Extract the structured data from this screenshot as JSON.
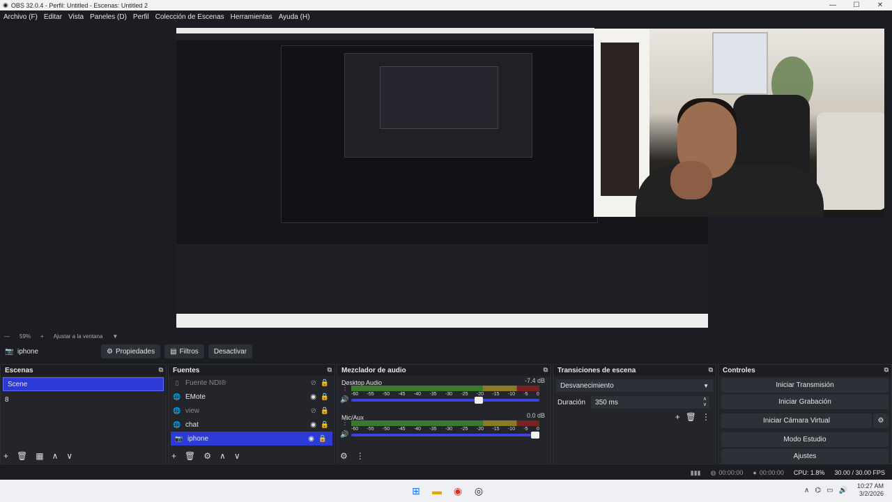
{
  "window": {
    "title": "OBS 32.0.4 - Perfil: Untitled - Escenas: Untitled 2",
    "min": "—",
    "max": "☐",
    "close": "✕"
  },
  "menu": [
    "Archivo (F)",
    "Editar",
    "Vista",
    "Paneles (D)",
    "Perfil",
    "Colección de Escenas",
    "Herramientas",
    "Ayuda (H)"
  ],
  "zoom": {
    "level": "59%",
    "fit": "Ajustar a la ventana"
  },
  "source_toolbar": {
    "name": "iphone",
    "properties": "Propiedades",
    "filters": "Filtros",
    "deactivate": "Desactivar"
  },
  "scenes": {
    "title": "Escenas",
    "items": [
      "Scene",
      "8"
    ]
  },
  "sources": {
    "title": "Fuentes",
    "items": [
      {
        "name": "Fuente NDI®",
        "icon": "ndi-icon",
        "dim": true
      },
      {
        "name": "EMote",
        "icon": "globe-icon",
        "dim": false
      },
      {
        "name": "view",
        "icon": "globe-icon",
        "dim": true
      },
      {
        "name": "chat",
        "icon": "globe-icon",
        "dim": false
      },
      {
        "name": "iphone",
        "icon": "camera-icon",
        "dim": false
      }
    ]
  },
  "mixer": {
    "title": "Mezclador de audio",
    "ticks": [
      "-60",
      "-55",
      "-50",
      "-45",
      "-40",
      "-35",
      "-30",
      "-25",
      "-20",
      "-15",
      "-10",
      "-5",
      "0"
    ],
    "channels": [
      {
        "name": "Desktop Audio",
        "db": "-7.4 dB",
        "volume": 0.7
      },
      {
        "name": "Mic/Aux",
        "db": "0.0 dB",
        "volume": 1.0
      }
    ]
  },
  "transitions": {
    "title": "Transiciones de escena",
    "selected": "Desvanecimiento",
    "duration_label": "Duración",
    "duration_value": "350 ms"
  },
  "controls": {
    "title": "Controles",
    "buttons": [
      "Iniciar Transmisión",
      "Iniciar Grabación",
      "Iniciar Cámara Virtual",
      "Modo Estudio",
      "Ajustes"
    ]
  },
  "status": {
    "stream_time": "00:00:00",
    "rec_time": "00:00:00",
    "cpu": "CPU: 1.8%",
    "fps": "30.00 / 30.00 FPS"
  },
  "taskbar": {
    "time": "10:27 AM",
    "date": "3/2/2026"
  },
  "colors": {
    "selection": "#2c3ad6",
    "background": "#1c1d22",
    "dock": "#23252b"
  }
}
